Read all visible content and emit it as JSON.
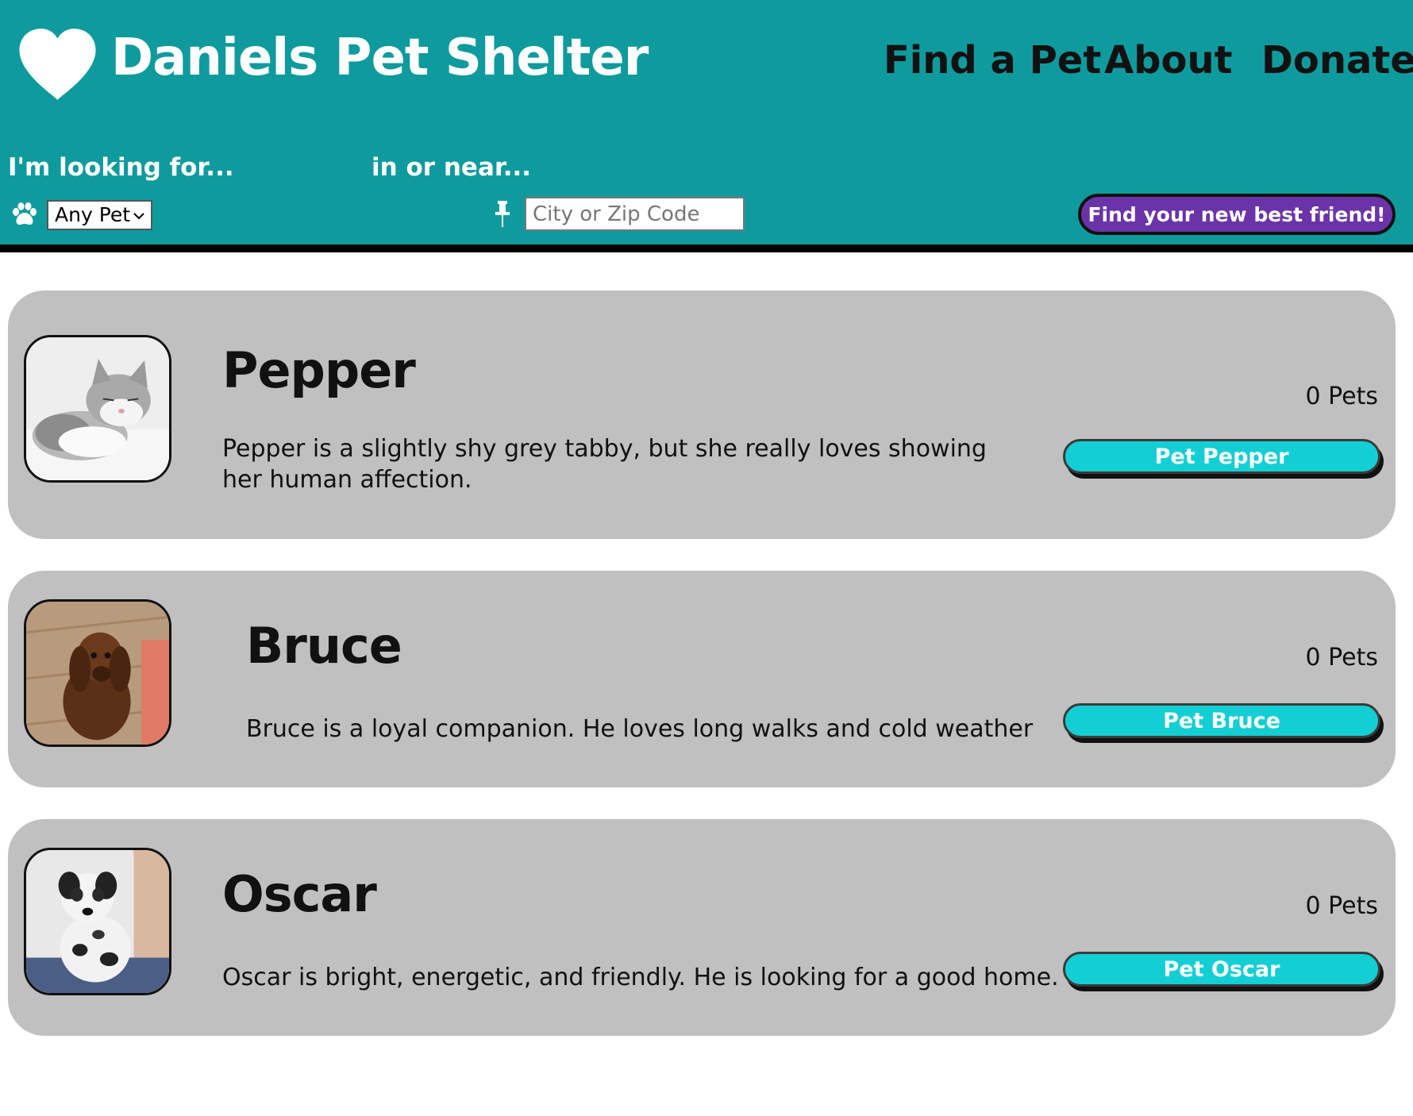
{
  "header": {
    "site_title": "Daniels Pet Shelter",
    "logo_icon": "heart-icon",
    "nav": [
      {
        "label": "Find a Pet"
      },
      {
        "label": "About"
      },
      {
        "label": "Donate"
      }
    ]
  },
  "search": {
    "looking_label": "I'm looking for...",
    "near_label": "in or near...",
    "pet_type_value": "Any Pet",
    "location_placeholder": "City or Zip Code",
    "location_value": "",
    "submit_label": "Find your new best friend!"
  },
  "colors": {
    "header_bg": "#0f9b9e",
    "card_bg": "#c0c0c0",
    "submit_bg": "#6a34a8",
    "pet_button_bg": "#13cfd4"
  },
  "pets": [
    {
      "name": "Pepper",
      "description": "Pepper is a slightly shy grey tabby, but she really loves showing her human affection.",
      "count": "0 Pets",
      "button_label": "Pet Pepper",
      "photo": "grey tabby cat photo"
    },
    {
      "name": "Bruce",
      "description": "Bruce is a loyal companion. He loves long walks and cold weather",
      "count": "0 Pets",
      "button_label": "Pet Bruce",
      "photo": "brown dachshund photo"
    },
    {
      "name": "Oscar",
      "description": "Oscar is bright, energetic, and friendly. He is looking for a good home.",
      "count": "0 Pets",
      "button_label": "Pet Oscar",
      "photo": "spotted puppy photo"
    }
  ]
}
